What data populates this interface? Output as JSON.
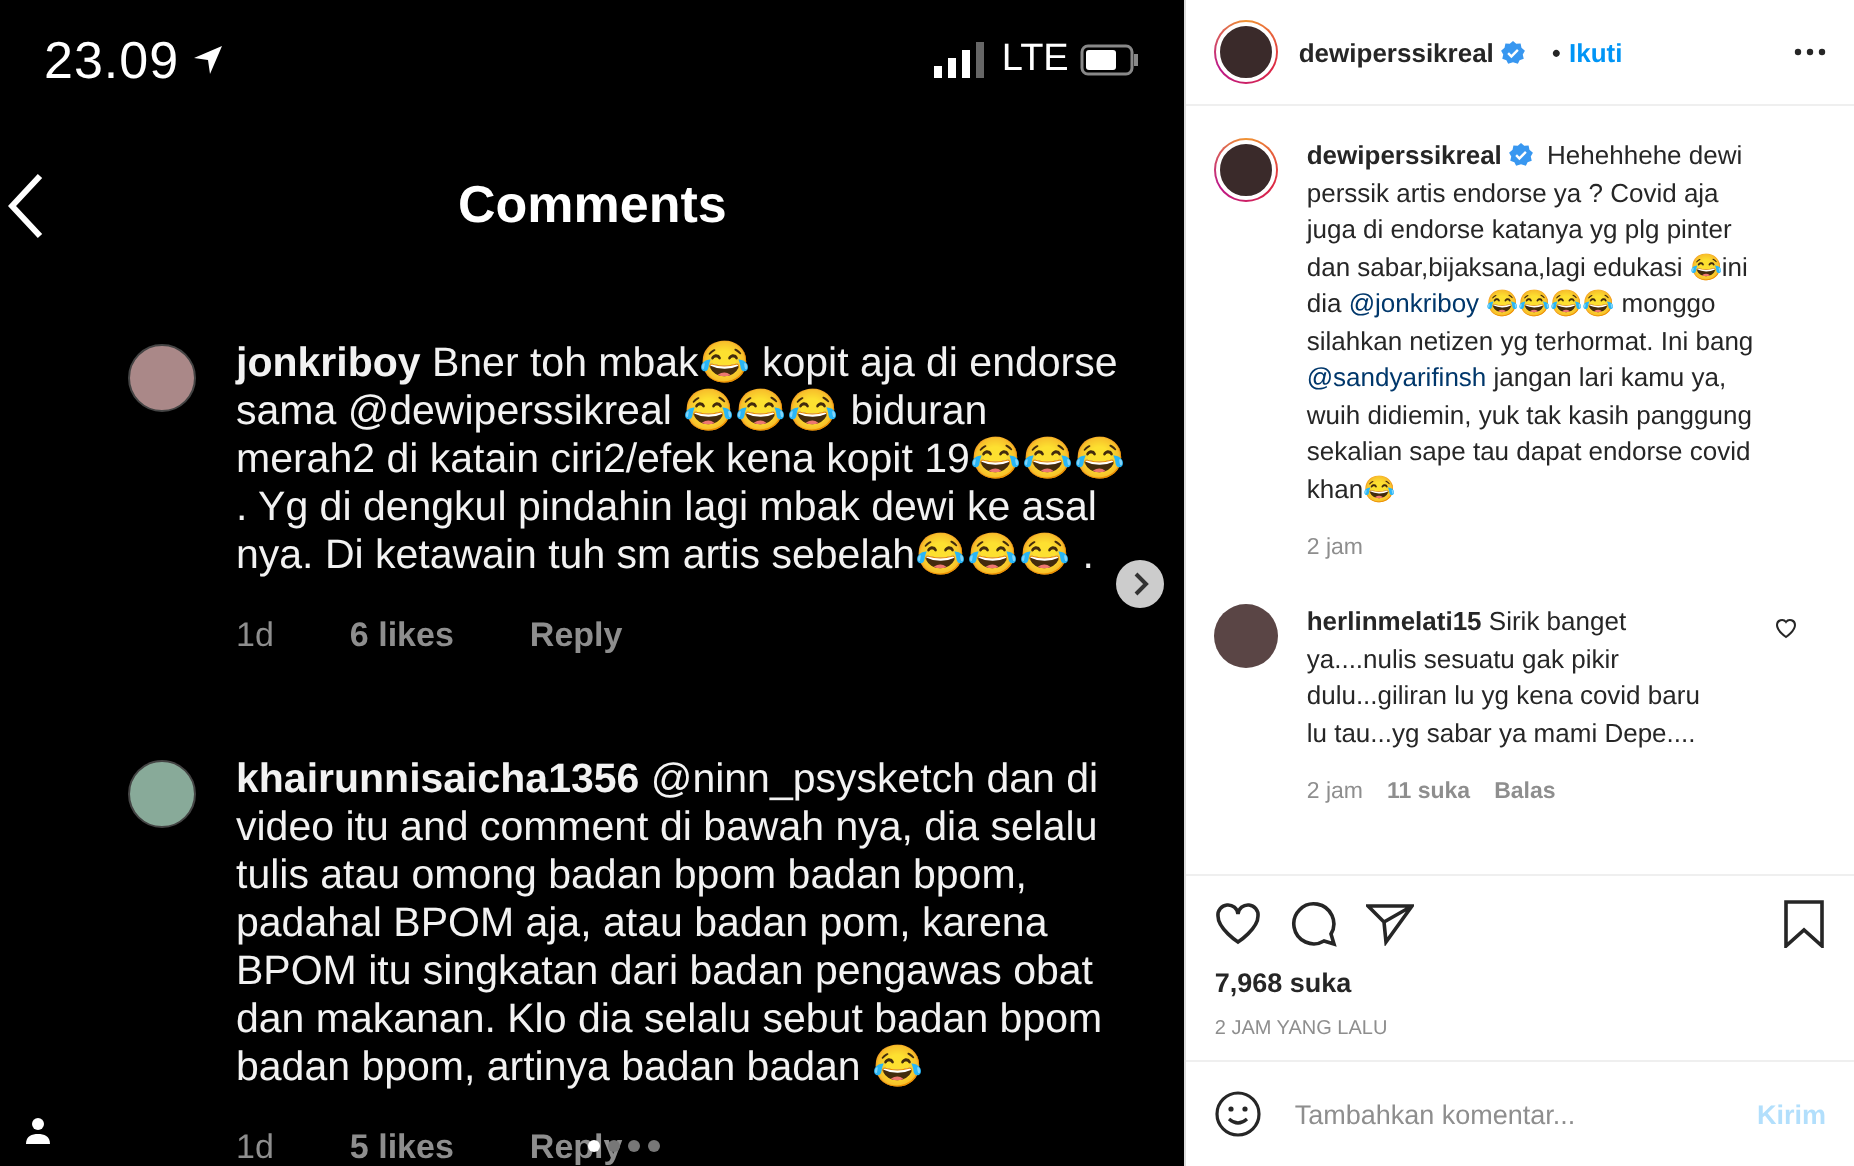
{
  "phone": {
    "time": "23.09",
    "network": "LTE",
    "title": "Comments",
    "comments": [
      {
        "user": "jonkriboy",
        "text": "Bner toh mbak😂 kopit aja di endorse sama @dewiperssikreal 😂😂😂 biduran merah2 di katain ciri2/efek kena kopit 19😂😂😂 . Yg di dengkul pindahin lagi mbak dewi ke asal nya. Di ketawain tuh sm artis sebelah😂😂😂 .",
        "age": "1d",
        "likes": "6 likes",
        "reply": "Reply"
      },
      {
        "user": "khairunnisaicha1356",
        "text": "@ninn_psysketch dan di video itu and comment di bawah nya, dia selalu tulis atau omong badan bpom badan bpom, padahal BPOM aja, atau badan pom, karena BPOM itu singkatan dari badan pengawas obat dan makanan. Klo dia selalu sebut badan bpom badan bpom, artinya badan badan 😂",
        "age": "1d",
        "likes": "5 likes",
        "reply": "Reply"
      }
    ]
  },
  "post": {
    "user": "dewiperssikreal",
    "verified": true,
    "separator": "•",
    "follow": "Ikuti",
    "caption_user": "dewiperssikreal",
    "caption_verified": true,
    "caption": [
      {
        "kind": "text",
        "text": "Hehehhehe dewi perssik artis endorse ya ? Covid aja juga di endorse katanya yg plg pinter dan sabar,bijaksana,lagi edukasi 😂ini dia "
      },
      {
        "kind": "mention",
        "text": "@jonkriboy"
      },
      {
        "kind": "text",
        "text": " 😂😂😂😂 monggo silahkan netizen yg terhormat. Ini bang "
      },
      {
        "kind": "mention",
        "text": "@sandyarifinsh"
      },
      {
        "kind": "text",
        "text": " jangan lari kamu ya, wuih didiemin, yuk tak kasih panggung sekalian sape tau dapat endorse covid khan😂"
      }
    ],
    "caption_age": "2 jam",
    "comments": [
      {
        "user": "herlinmelati15",
        "text": "Sirik banget ya....nulis sesuatu gak pikir dulu...giliran lu yg kena covid baru lu tau...yg sabar ya mami Depe....",
        "age": "2 jam",
        "likes": "11 suka",
        "reply": "Balas",
        "liked": false
      }
    ],
    "likes": "7,968 suka",
    "time": "2 JAM YANG LALU",
    "saved": false,
    "input": {
      "placeholder": "Tambahkan komentar...",
      "submit": "Kirim"
    }
  }
}
